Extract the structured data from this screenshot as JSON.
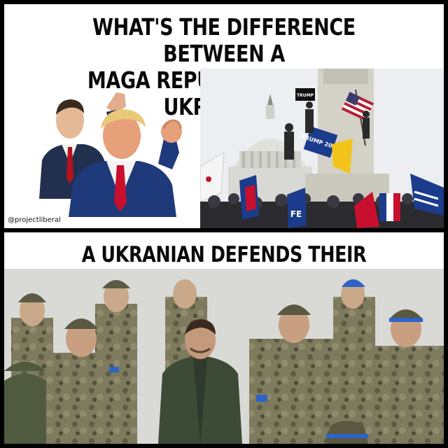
{
  "meme": {
    "top_headline_line1": "WHAT'S THE DIFFERENCE BETWEEN A",
    "top_headline_line2": "MAGA REPUBLICAN AND A UKRANIAN?",
    "watermark": "@projectliberal",
    "bottom_headline": "A UKRANIAN DEFENDS THEIR CAPITOL",
    "sign_trump": "TRUMP",
    "flag_trump_2020": "TRUMP 2020",
    "flag_fragment": "FE"
  },
  "colors": {
    "background": "#000000",
    "panel": "#ffffff",
    "suit_navy": "#1f3a7a",
    "tie_red": "#c8102e",
    "camo_base": "#7d7a5e",
    "ukraine_blue": "#2f63c7"
  },
  "icons": {
    "capitol": "capitol-dome-icon",
    "flag": "american-flag-icon"
  }
}
